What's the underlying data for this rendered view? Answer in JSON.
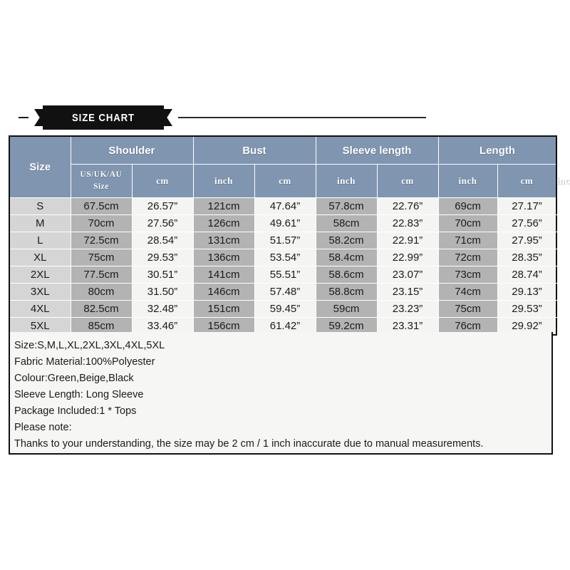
{
  "banner": {
    "title": "SIZE CHART",
    "icon_left": "ribbon-flag-left-icon",
    "icon_right": "ribbon-flag-right-icon",
    "colors": {
      "banner_bg": "#111111",
      "banner_text": "#ffffff",
      "rule": "#2b2b2b"
    }
  },
  "colors": {
    "header_blue": "#8095b0",
    "size_cell": "#d5d5d5",
    "cm_cell": "#b3b3b3",
    "inch_cell": "#f4f4f2",
    "border": "#111111",
    "panel_bg": "#f6f6f4",
    "text": "#1b1b1b"
  },
  "table": {
    "groups": [
      {
        "label": "Size",
        "span": 1
      },
      {
        "label": "Shoulder",
        "span": 2
      },
      {
        "label": "Bust",
        "span": 2
      },
      {
        "label": "Sleeve length",
        "span": 2
      },
      {
        "label": "Length",
        "span": 2
      }
    ],
    "units": [
      "US/UK/AU\nSize",
      "cm",
      "inch",
      "cm",
      "inch",
      "cm",
      "inch",
      "cm",
      "inch"
    ],
    "unit_size_line1": "US/UK/AU",
    "unit_size_line2": "Size",
    "rows": [
      {
        "size": "S",
        "shoulder_cm": "67.5cm",
        "shoulder_inch": "26.57”",
        "bust_cm": "121cm",
        "bust_inch": "47.64”",
        "sleeve_cm": "57.8cm",
        "sleeve_inch": "22.76”",
        "length_cm": "69cm",
        "length_inch": "27.17”"
      },
      {
        "size": "M",
        "shoulder_cm": "70cm",
        "shoulder_inch": "27.56”",
        "bust_cm": "126cm",
        "bust_inch": "49.61”",
        "sleeve_cm": "58cm",
        "sleeve_inch": "22.83”",
        "length_cm": "70cm",
        "length_inch": "27.56”"
      },
      {
        "size": "L",
        "shoulder_cm": "72.5cm",
        "shoulder_inch": "28.54”",
        "bust_cm": "131cm",
        "bust_inch": "51.57”",
        "sleeve_cm": "58.2cm",
        "sleeve_inch": "22.91”",
        "length_cm": "71cm",
        "length_inch": "27.95”"
      },
      {
        "size": "XL",
        "shoulder_cm": "75cm",
        "shoulder_inch": "29.53”",
        "bust_cm": "136cm",
        "bust_inch": "53.54”",
        "sleeve_cm": "58.4cm",
        "sleeve_inch": "22.99”",
        "length_cm": "72cm",
        "length_inch": "28.35”"
      },
      {
        "size": "2XL",
        "shoulder_cm": "77.5cm",
        "shoulder_inch": "30.51”",
        "bust_cm": "141cm",
        "bust_inch": "55.51”",
        "sleeve_cm": "58.6cm",
        "sleeve_inch": "23.07”",
        "length_cm": "73cm",
        "length_inch": "28.74”"
      },
      {
        "size": "3XL",
        "shoulder_cm": "80cm",
        "shoulder_inch": "31.50”",
        "bust_cm": "146cm",
        "bust_inch": "57.48”",
        "sleeve_cm": "58.8cm",
        "sleeve_inch": "23.15”",
        "length_cm": "74cm",
        "length_inch": "29.13”"
      },
      {
        "size": "4XL",
        "shoulder_cm": "82.5cm",
        "shoulder_inch": "32.48”",
        "bust_cm": "151cm",
        "bust_inch": "59.45”",
        "sleeve_cm": "59cm",
        "sleeve_inch": "23.23”",
        "length_cm": "75cm",
        "length_inch": "29.53”"
      },
      {
        "size": "5XL",
        "shoulder_cm": "85cm",
        "shoulder_inch": "33.46”",
        "bust_cm": "156cm",
        "bust_inch": "61.42”",
        "sleeve_cm": "59.2cm",
        "sleeve_inch": "23.31”",
        "length_cm": "76cm",
        "length_inch": "29.92”"
      }
    ]
  },
  "description": {
    "lines": [
      "Size:S,M,L,XL,2XL,3XL,4XL,5XL",
      "Fabric Material:100%Polyester",
      "Colour:Green,Beige,Black",
      "Sleeve Length: Long Sleeve",
      "Package Included:1 * Tops",
      "Please note:",
      "Thanks to your understanding, the size may be 2 cm / 1 inch inaccurate due to manual measurements."
    ]
  }
}
